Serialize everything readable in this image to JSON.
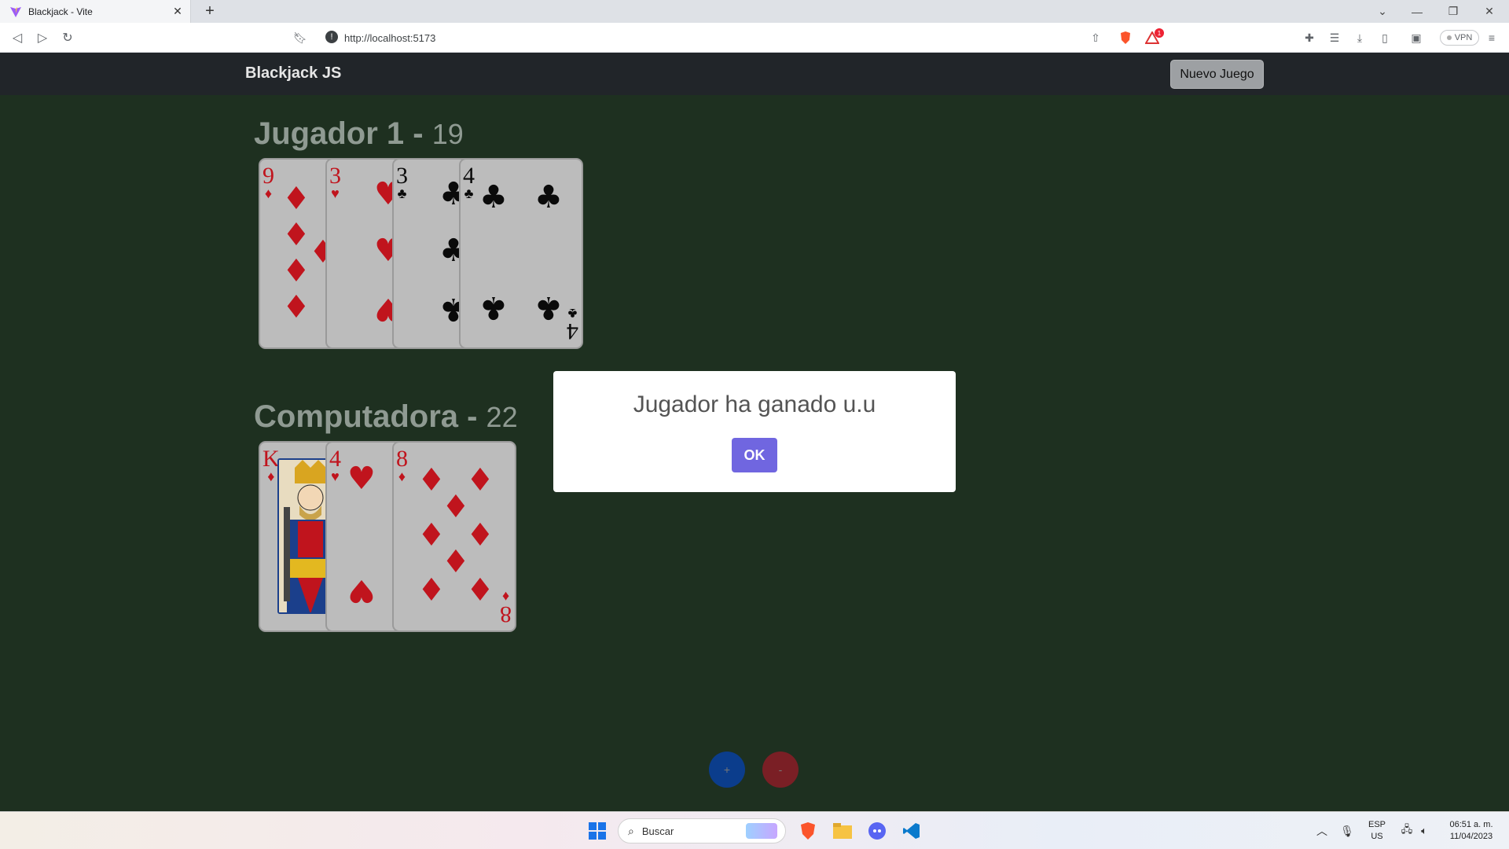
{
  "browser": {
    "tab_title": "Blackjack - Vite",
    "url": "http://localhost:5173",
    "vpn_label": "VPN",
    "notification_count": "1"
  },
  "app": {
    "brand": "Blackjack JS",
    "new_game_label": "Nuevo Juego"
  },
  "player": {
    "name": "Jugador 1",
    "separator": " - ",
    "score": "19",
    "cards": [
      {
        "rank": "9",
        "suit": "♦",
        "color": "red"
      },
      {
        "rank": "3",
        "suit": "♥",
        "color": "red"
      },
      {
        "rank": "3",
        "suit": "♣",
        "color": "black"
      },
      {
        "rank": "4",
        "suit": "♣",
        "color": "black"
      }
    ]
  },
  "computer": {
    "name": "Computadora",
    "separator": " - ",
    "score": "22",
    "cards": [
      {
        "rank": "K",
        "suit": "♦",
        "color": "red"
      },
      {
        "rank": "4",
        "suit": "♥",
        "color": "red"
      },
      {
        "rank": "8",
        "suit": "♦",
        "color": "red"
      }
    ]
  },
  "controls": {
    "hit_label": "+",
    "stand_label": "-",
    "hit_color": "#0b3d8c",
    "stand_color": "#7a1f25"
  },
  "modal": {
    "title": "Jugador ha ganado u.u",
    "ok_label": "OK",
    "ok_color": "#7066e0"
  },
  "taskbar": {
    "search_placeholder": "Buscar",
    "lang_line1": "ESP",
    "lang_line2": "US",
    "time": "06:51 a. m.",
    "date": "11/04/2023"
  }
}
